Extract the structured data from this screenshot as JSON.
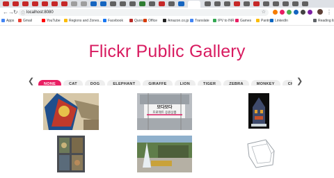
{
  "browser": {
    "url": "localhost:8080",
    "bookmarks": [
      {
        "label": "Apps",
        "color": "#4285f4"
      },
      {
        "label": "Gmail",
        "color": "#ea4335"
      },
      {
        "label": "YouTube",
        "color": "#ff0000"
      },
      {
        "label": "Regions and Zones...",
        "color": "#fbbc04"
      },
      {
        "label": "Facebook",
        "color": "#1877f2"
      },
      {
        "label": "Quora",
        "color": "#b92b27"
      },
      {
        "label": "Office",
        "color": "#d83b01"
      },
      {
        "label": "Amazon.co.jp",
        "color": "#222222"
      },
      {
        "label": "Translate",
        "color": "#4285f4"
      },
      {
        "label": "IPV to INR",
        "color": "#34a853"
      },
      {
        "label": "Games",
        "color": "#e91e63"
      },
      {
        "label": "Pantry",
        "color": "#fbbc04"
      },
      {
        "label": "LinkedIn",
        "color": "#0a66c2"
      },
      {
        "label": "Reading list",
        "color": "#5f6368"
      }
    ]
  },
  "page": {
    "title": "Flickr Public Gallery",
    "filters": [
      "NONE",
      "CAT",
      "DOG",
      "ELEPHANT",
      "GIRAFFE",
      "LION",
      "TIGER",
      "ZEBRA",
      "MONKEY",
      "CHIMPANZEE"
    ],
    "active_filter": "NONE",
    "accent_color": "#e91e63",
    "photos": [
      {
        "name": "photo-knitted-items"
      },
      {
        "name": "photo-korean-storefront",
        "sign_line1": "모다모다",
        "sign_line2": "프로젝트 응원상품"
      },
      {
        "name": "photo-lit-building-night"
      },
      {
        "name": "photo-display-case"
      },
      {
        "name": "photo-fountain-plaza"
      },
      {
        "name": "photo-line-drawing-model"
      }
    ]
  }
}
